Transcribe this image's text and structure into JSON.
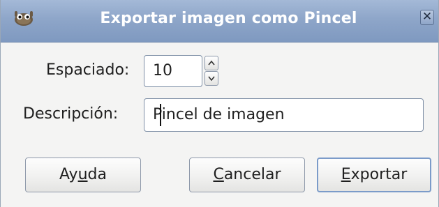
{
  "window": {
    "title": "Exportar imagen como Pincel",
    "app_icon": "gimp-wilber-icon",
    "close_icon": "close-icon"
  },
  "form": {
    "spacing_label": "Espaciado:",
    "spacing_value": "10",
    "description_label": "Descripción:",
    "description_value": "Pincel de imagen"
  },
  "buttons": {
    "help_pre": "Ay",
    "help_mnemonic": "u",
    "help_post": "da",
    "cancel_mnemonic": "C",
    "cancel_post": "ancelar",
    "export_mnemonic": "E",
    "export_post": "xportar"
  },
  "colors": {
    "titlebar": "#8ea6c9",
    "background": "#f4f4f3",
    "default_button_border": "#7b9bc9"
  }
}
